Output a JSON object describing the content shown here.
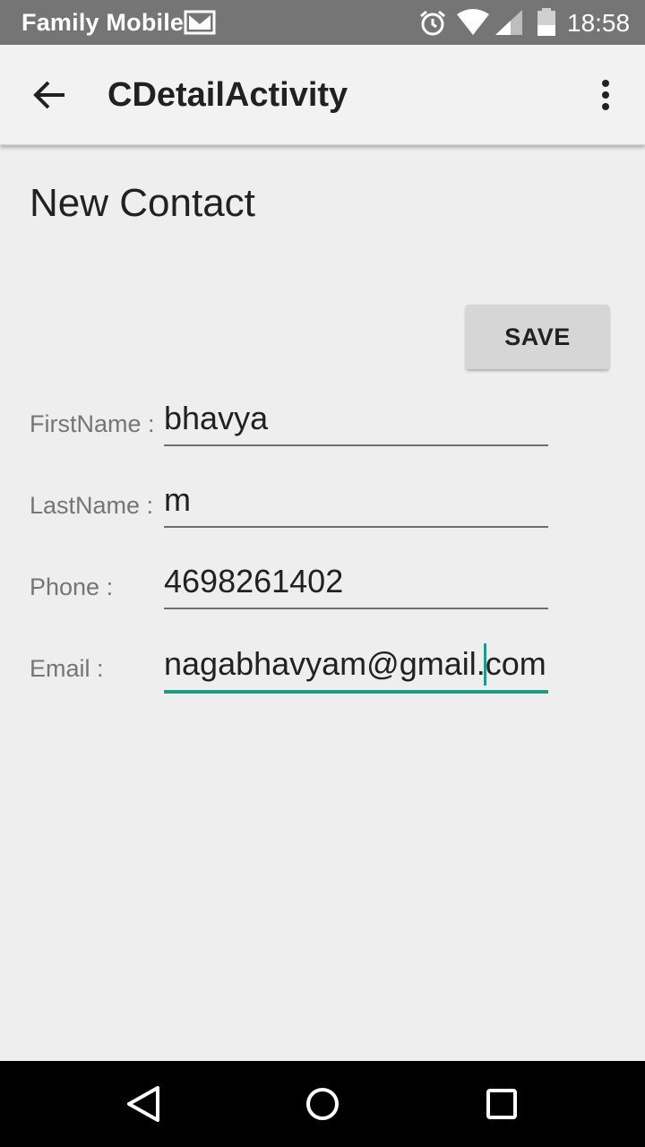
{
  "status_bar": {
    "carrier": "Family Mobile",
    "time": "18:58",
    "icons": [
      "mail-icon",
      "alarm-icon",
      "wifi-icon",
      "signal-icon",
      "battery-icon"
    ]
  },
  "app_bar": {
    "title": "CDetailActivity",
    "icons": [
      "back-arrow-icon",
      "overflow-menu-icon"
    ]
  },
  "page": {
    "title": "New Contact",
    "save_label": "SAVE"
  },
  "form": {
    "first_name": {
      "label": "FirstName :",
      "value": "bhavya"
    },
    "last_name": {
      "label": "LastName :",
      "value": "m"
    },
    "phone": {
      "label": "Phone :",
      "value": "4698261402"
    },
    "email": {
      "label": "Email :",
      "value": "nagabhavyam@gmail.com"
    }
  },
  "nav_bar": {
    "icons": [
      "nav-back-icon",
      "nav-home-icon",
      "nav-recents-icon"
    ]
  },
  "colors": {
    "status_bar": "#757575",
    "app_bar": "#f2f2f2",
    "background": "#eeeeee",
    "accent": "#1f9a8a",
    "button": "#d6d6d6",
    "nav_bar": "#000000"
  }
}
